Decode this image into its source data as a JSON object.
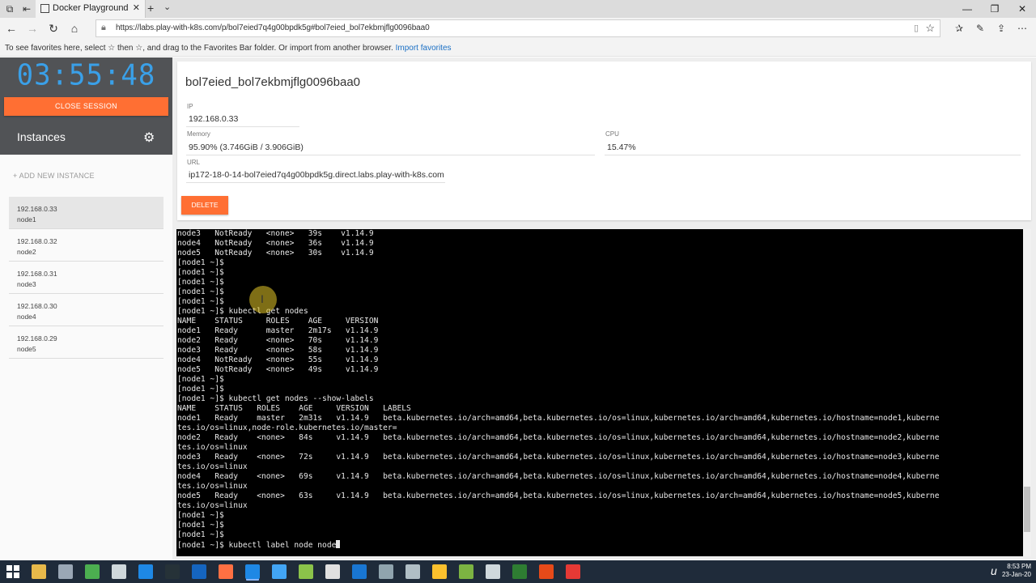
{
  "browser": {
    "tab_title": "Docker Playground",
    "tab_close": "✕",
    "new_tab": "+",
    "tab_list": "⌄",
    "url": "https://labs.play-with-k8s.com/p/bol7eied7q4g00bpdk5g#bol7eied_bol7ekbmjflg0096baa0",
    "favorites_hint": "To see favorites here, select  ☆  then ☆, and drag to the Favorites Bar folder. Or import from another browser.",
    "import_favorites": "Import favorites",
    "icons": {
      "back": "back-arrow-icon",
      "forward": "forward-arrow-icon",
      "refresh": "refresh-icon",
      "home": "home-icon",
      "minimize": "minimize-icon",
      "maximize": "maximize-icon",
      "close": "close-icon"
    }
  },
  "sidebar": {
    "timer": "03:55:48",
    "close_session": "CLOSE SESSION",
    "instances_title": "Instances",
    "add_instance": "+ ADD NEW INSTANCE",
    "instances": [
      {
        "ip": "192.168.0.33",
        "name": "node1"
      },
      {
        "ip": "192.168.0.32",
        "name": "node2"
      },
      {
        "ip": "192.168.0.31",
        "name": "node3"
      },
      {
        "ip": "192.168.0.30",
        "name": "node4"
      },
      {
        "ip": "192.168.0.29",
        "name": "node5"
      }
    ],
    "selected_instance": "node1"
  },
  "instance_card": {
    "title": "bol7eied_bol7ekbmjflg0096baa0",
    "ip_label": "IP",
    "ip_value": "192.168.0.33",
    "memory_label": "Memory",
    "memory_value": "95.90% (3.746GiB / 3.906GiB)",
    "cpu_label": "CPU",
    "cpu_value": "15.47%",
    "url_label": "URL",
    "url_value": "ip172-18-0-14-bol7eied7q4g00bpdk5g.direct.labs.play-with-k8s.com",
    "delete": "DELETE"
  },
  "terminal": {
    "lines": [
      "node3   NotReady   <none>   39s    v1.14.9",
      "node4   NotReady   <none>   36s    v1.14.9",
      "node5   NotReady   <none>   30s    v1.14.9",
      "[node1 ~]$",
      "[node1 ~]$",
      "[node1 ~]$",
      "[node1 ~]$",
      "[node1 ~]$",
      "[node1 ~]$ kubectl get nodes",
      "NAME    STATUS     ROLES    AGE     VERSION",
      "node1   Ready      master   2m17s   v1.14.9",
      "node2   Ready      <none>   70s     v1.14.9",
      "node3   Ready      <none>   58s     v1.14.9",
      "node4   NotReady   <none>   55s     v1.14.9",
      "node5   NotReady   <none>   49s     v1.14.9",
      "[node1 ~]$",
      "[node1 ~]$",
      "[node1 ~]$ kubectl get nodes --show-labels",
      "NAME    STATUS   ROLES    AGE     VERSION   LABELS",
      "node1   Ready    master   2m31s   v1.14.9   beta.kubernetes.io/arch=amd64,beta.kubernetes.io/os=linux,kubernetes.io/arch=amd64,kubernetes.io/hostname=node1,kuberne",
      "tes.io/os=linux,node-role.kubernetes.io/master=",
      "node2   Ready    <none>   84s     v1.14.9   beta.kubernetes.io/arch=amd64,beta.kubernetes.io/os=linux,kubernetes.io/arch=amd64,kubernetes.io/hostname=node2,kuberne",
      "tes.io/os=linux",
      "node3   Ready    <none>   72s     v1.14.9   beta.kubernetes.io/arch=amd64,beta.kubernetes.io/os=linux,kubernetes.io/arch=amd64,kubernetes.io/hostname=node3,kuberne",
      "tes.io/os=linux",
      "node4   Ready    <none>   69s     v1.14.9   beta.kubernetes.io/arch=amd64,beta.kubernetes.io/os=linux,kubernetes.io/arch=amd64,kubernetes.io/hostname=node4,kuberne",
      "tes.io/os=linux",
      "node5   Ready    <none>   63s     v1.14.9   beta.kubernetes.io/arch=amd64,beta.kubernetes.io/os=linux,kubernetes.io/arch=amd64,kubernetes.io/hostname=node5,kuberne",
      "tes.io/os=linux",
      "[node1 ~]$",
      "[node1 ~]$",
      "[node1 ~]$",
      "[node1 ~]$ kubectl label node node"
    ]
  },
  "taskbar": {
    "time": "8:53 PM",
    "date": "23-Jan-20",
    "tray_logo": "u",
    "apps": [
      {
        "name": "file-explorer-icon",
        "color": "#e8b94a"
      },
      {
        "name": "paint-icon",
        "color": "#9aa7b5"
      },
      {
        "name": "recycle-icon",
        "color": "#4caf50"
      },
      {
        "name": "calculator-icon",
        "color": "#cfd8dc"
      },
      {
        "name": "skype-icon",
        "color": "#1e88e5"
      },
      {
        "name": "terminal-icon",
        "color": "#263238"
      },
      {
        "name": "powershell-icon",
        "color": "#1565c0"
      },
      {
        "name": "firefox-icon",
        "color": "#ff7043"
      },
      {
        "name": "edge-icon",
        "color": "#1e88e5"
      },
      {
        "name": "ie-icon",
        "color": "#42a5f5"
      },
      {
        "name": "photos-icon",
        "color": "#8bc34a"
      },
      {
        "name": "store-icon",
        "color": "#e0e0e0"
      },
      {
        "name": "network-icon",
        "color": "#1976d2"
      },
      {
        "name": "remote-desktop-icon",
        "color": "#90a4ae"
      },
      {
        "name": "globe-icon",
        "color": "#b0bec5"
      },
      {
        "name": "chrome-icon",
        "color": "#fbc02d"
      },
      {
        "name": "notepad-plus-icon",
        "color": "#7cb342"
      },
      {
        "name": "mail-icon",
        "color": "#cfd8dc"
      },
      {
        "name": "excel-icon",
        "color": "#2e7d32"
      },
      {
        "name": "powerpoint-icon",
        "color": "#e64a19"
      },
      {
        "name": "recorder-icon",
        "color": "#e53935"
      }
    ]
  }
}
